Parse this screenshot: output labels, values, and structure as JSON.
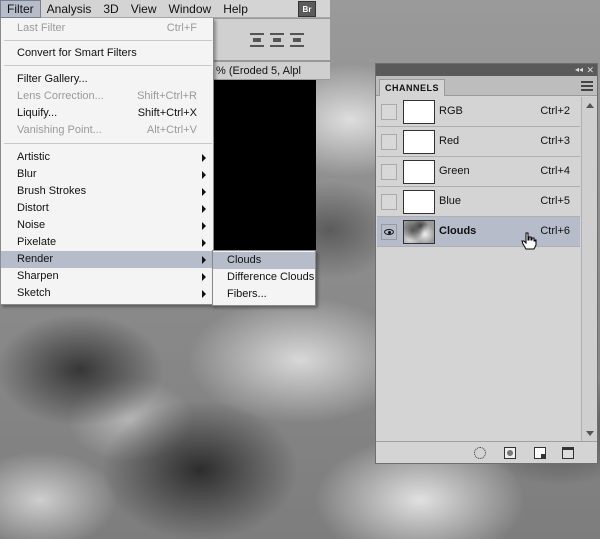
{
  "menubar": {
    "items": [
      "Filter",
      "Analysis",
      "3D",
      "View",
      "Window",
      "Help"
    ],
    "bridge_label": "Br"
  },
  "document": {
    "tab_title": "% (Eroded 5, Alpl"
  },
  "filter_menu": {
    "last_filter": {
      "label": "Last Filter",
      "shortcut": "Ctrl+F"
    },
    "convert": {
      "label": "Convert for Smart Filters"
    },
    "gallery": {
      "label": "Filter Gallery..."
    },
    "lens": {
      "label": "Lens Correction...",
      "shortcut": "Shift+Ctrl+R"
    },
    "liquify": {
      "label": "Liquify...",
      "shortcut": "Shift+Ctrl+X"
    },
    "vanishing": {
      "label": "Vanishing Point...",
      "shortcut": "Alt+Ctrl+V"
    },
    "submenus": [
      "Artistic",
      "Blur",
      "Brush Strokes",
      "Distort",
      "Noise",
      "Pixelate",
      "Render",
      "Sharpen",
      "Sketch"
    ]
  },
  "render_submenu": {
    "items": [
      "Clouds",
      "Difference Clouds",
      "Fibers..."
    ]
  },
  "channels": {
    "tab_label": "CHANNELS",
    "rows": [
      {
        "name": "RGB",
        "shortcut": "Ctrl+2"
      },
      {
        "name": "Red",
        "shortcut": "Ctrl+3"
      },
      {
        "name": "Green",
        "shortcut": "Ctrl+4"
      },
      {
        "name": "Blue",
        "shortcut": "Ctrl+5"
      },
      {
        "name": "Clouds",
        "shortcut": "Ctrl+6"
      }
    ]
  },
  "colors": {
    "highlight": "#b7bccb",
    "menu_bg": "#f4f4f4",
    "panel_bg": "#d4d4d4"
  }
}
